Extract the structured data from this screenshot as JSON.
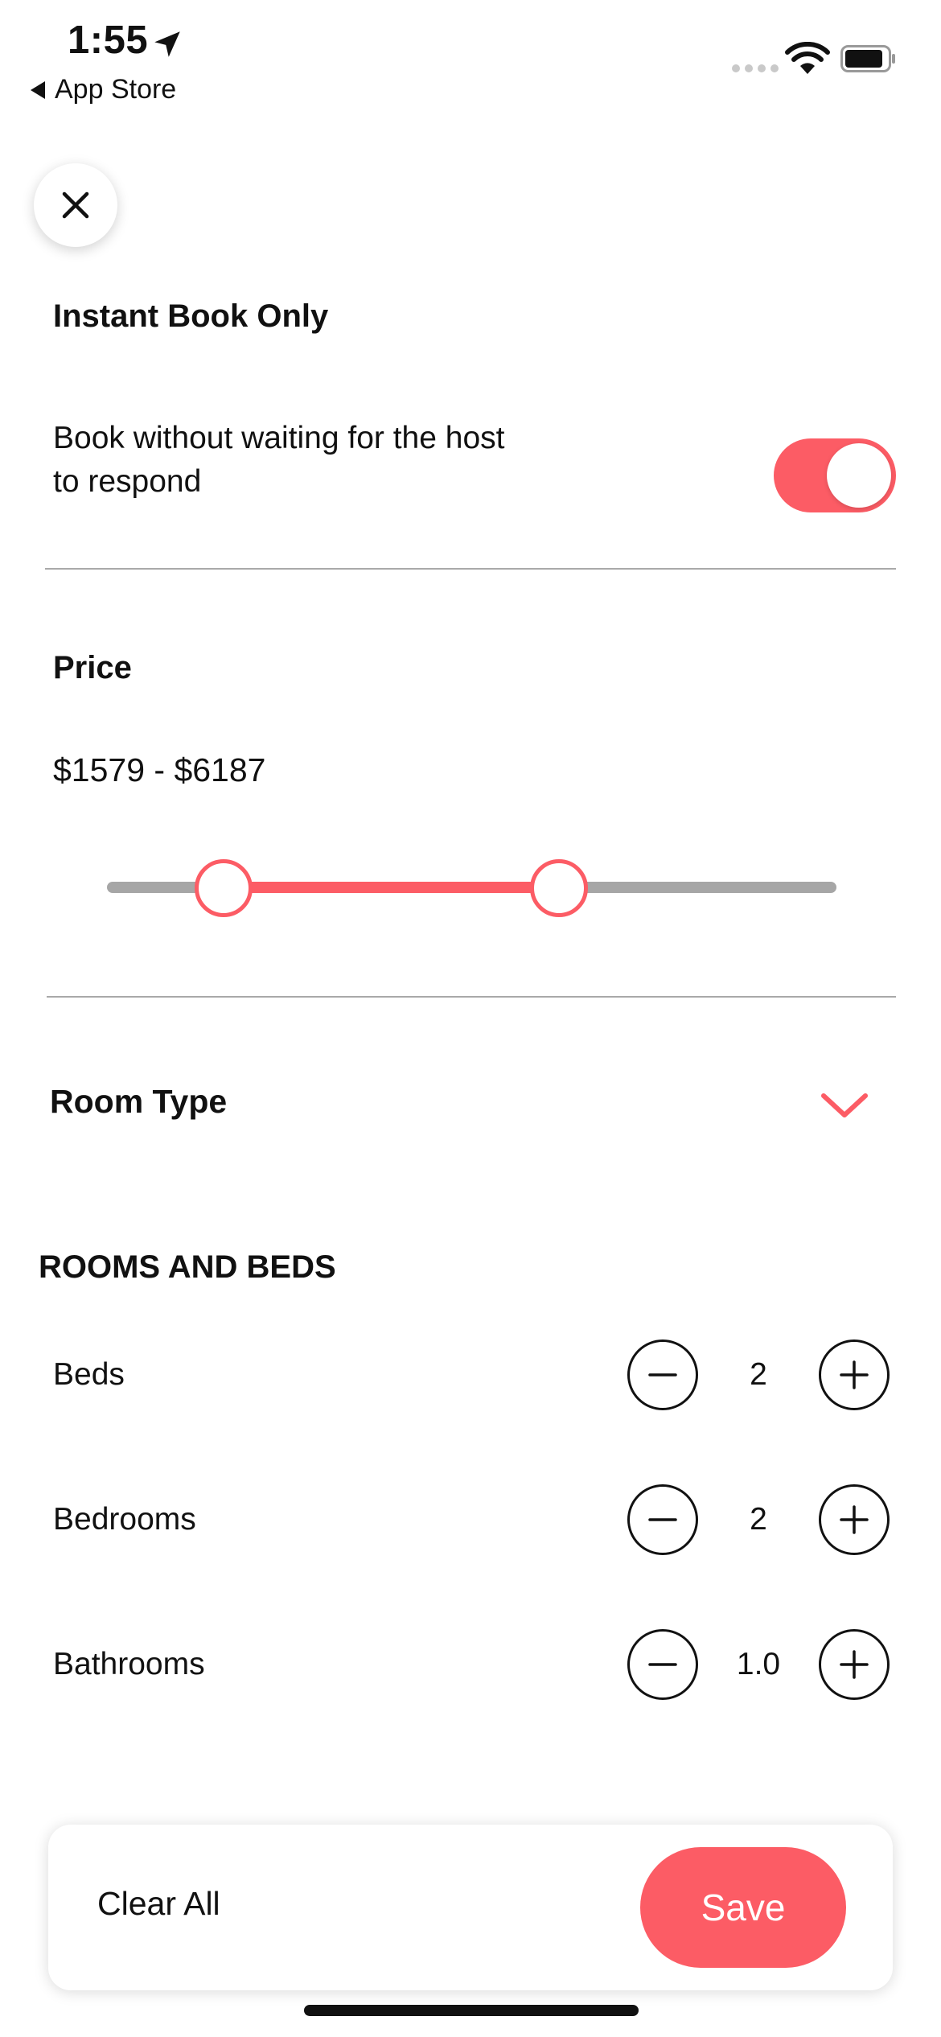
{
  "status_bar": {
    "time": "1:55",
    "back_label": "App Store"
  },
  "icons": {
    "close": "close-icon",
    "location": "location-arrow-icon",
    "wifi": "wifi-icon",
    "battery": "battery-icon",
    "chevron": "chevron-down-icon",
    "minus": "minus-icon",
    "plus": "plus-icon"
  },
  "colors": {
    "accent": "#fc5c65",
    "track": "#a6a6a6",
    "divider": "#a9a9a9"
  },
  "instant_book": {
    "title": "Instant Book Only",
    "description_line1": "Book without waiting for the host",
    "description_line2": "to respond",
    "enabled": true
  },
  "price": {
    "title": "Price",
    "range_label": "$1579 - $6187",
    "slider_min_fraction": 0.16,
    "slider_max_fraction": 0.62
  },
  "room_type": {
    "title": "Room Type"
  },
  "rooms_and_beds": {
    "title": "ROOMS AND BEDS",
    "rows": [
      {
        "label": "Beds",
        "value": "2"
      },
      {
        "label": "Bedrooms",
        "value": "2"
      },
      {
        "label": "Bathrooms",
        "value": "1.0"
      }
    ]
  },
  "footer": {
    "clear_label": "Clear All",
    "save_label": "Save"
  }
}
